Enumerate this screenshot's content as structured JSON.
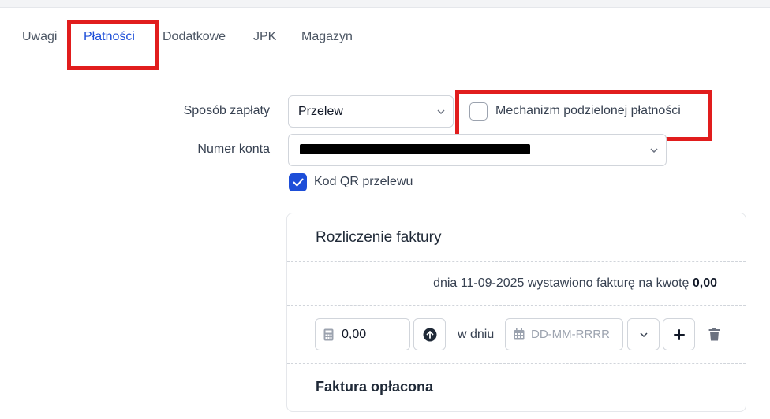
{
  "tabs": [
    {
      "label": "Uwagi",
      "active": false
    },
    {
      "label": "Płatności",
      "active": true
    },
    {
      "label": "Dodatkowe",
      "active": false
    },
    {
      "label": "JPK",
      "active": false
    },
    {
      "label": "Magazyn",
      "active": false
    }
  ],
  "payment": {
    "method_label": "Sposób zapłaty",
    "method_value": "Przelew",
    "split_payment_label": "Mechanizm podzielonej płatności",
    "split_payment_checked": false,
    "account_label": "Numer konta",
    "qr_label": "Kod QR przelewu",
    "qr_checked": true
  },
  "settlement": {
    "title": "Rozliczenie faktury",
    "issued_text": "dnia 11-09-2025 wystawiono fakturę na kwotę",
    "issued_amount": "0,00",
    "amount_value": "0,00",
    "on_day_label": "w dniu",
    "date_placeholder": "DD-MM-RRRR",
    "paid_title": "Faktura opłacona"
  },
  "colors": {
    "accent": "#1d4ed8",
    "highlight": "#e11d1d",
    "border": "#d1d5db"
  },
  "icons": [
    "calculator-icon",
    "arrow-up-circle-icon",
    "calendar-icon",
    "chevron-down-icon",
    "plus-icon",
    "trash-icon",
    "check-icon"
  ]
}
